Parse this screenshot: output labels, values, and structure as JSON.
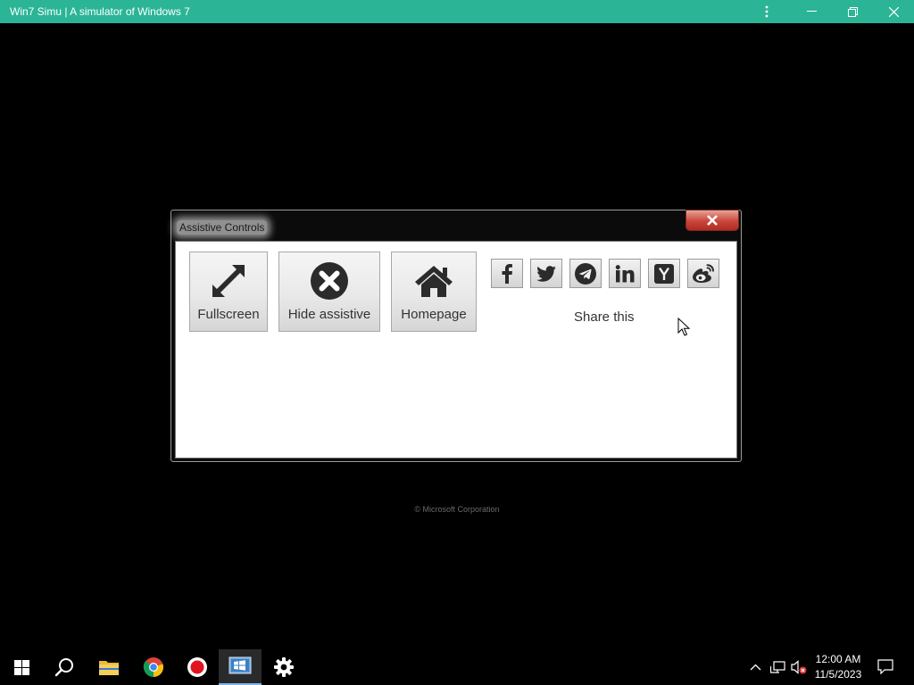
{
  "window": {
    "title": "Win7 Simu | A simulator of Windows 7"
  },
  "dialog": {
    "title": "Assistive Controls",
    "tiles": [
      {
        "label": "Fullscreen",
        "icon": "expand-arrows-icon"
      },
      {
        "label": "Hide assistive",
        "icon": "close-circle-icon"
      },
      {
        "label": "Homepage",
        "icon": "home-icon"
      }
    ],
    "share": {
      "label": "Share this",
      "buttons": [
        "facebook-icon",
        "twitter-icon",
        "telegram-icon",
        "linkedin-icon",
        "hacker-news-icon",
        "weibo-icon"
      ]
    }
  },
  "desktop": {
    "copyright": "© Microsoft Corporation"
  },
  "taskbar": {
    "apps": [
      "start-icon",
      "search-icon",
      "file-explorer-icon",
      "chrome-icon",
      "screen-recorder-icon",
      "win7simu-app-icon",
      "settings-icon"
    ],
    "active_app": "win7simu-app-icon",
    "time": "12:00 AM",
    "date": "11/5/2023"
  },
  "colors": {
    "titlebar": "#2bb596",
    "close_button": "#c8453a",
    "desktop": "#000000"
  }
}
